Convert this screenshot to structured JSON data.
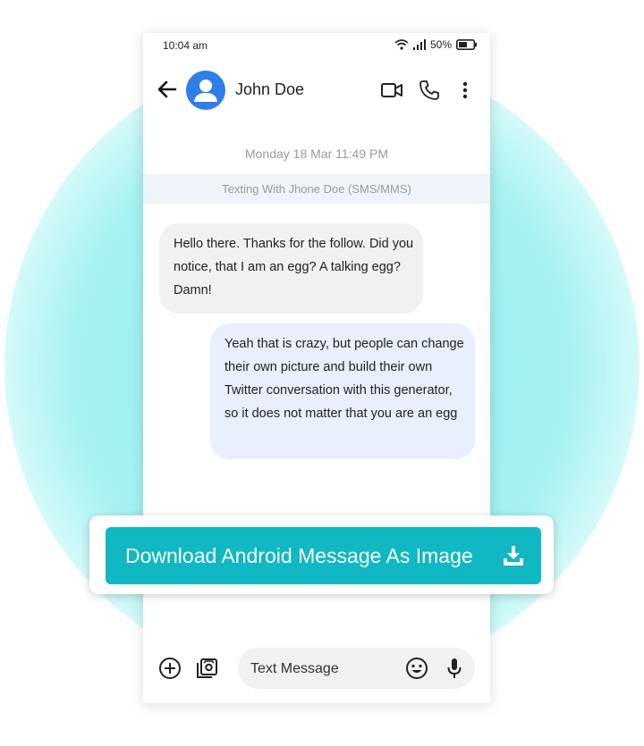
{
  "status_bar": {
    "time": "10:04 am",
    "battery": "50%"
  },
  "header": {
    "contact_name": "John Doe",
    "icons": [
      "back-arrow-icon",
      "avatar",
      "video-call-icon",
      "phone-icon",
      "more-vert-icon"
    ]
  },
  "conversation": {
    "date_label": "Monday 18 Mar 11:49 PM",
    "sms_banner": "Texting With Jhone Doe (SMS/MMS)",
    "messages": [
      {
        "direction": "incoming",
        "text": "Hello there. Thanks for the follow. Did you notice, that I am an egg? A talking egg? Damn!"
      },
      {
        "direction": "outgoing",
        "text": "Yeah that is crazy, but people can change their own picture and build their own Twitter conversation with this generator, so it does not matter that you are an egg"
      }
    ]
  },
  "composer": {
    "placeholder": "Text Message",
    "icons": [
      "add-icon",
      "gallery-icon",
      "emoji-icon",
      "mic-icon"
    ]
  },
  "download": {
    "label": "Download Android Message As Image",
    "icon": "download-icon"
  },
  "colors": {
    "accent": "#0fb8c3",
    "avatar": "#2f7fe8",
    "glow": "#a6f1f1",
    "outgoing_bubble": "#e9effc",
    "incoming_bubble": "#f1f1f1"
  }
}
